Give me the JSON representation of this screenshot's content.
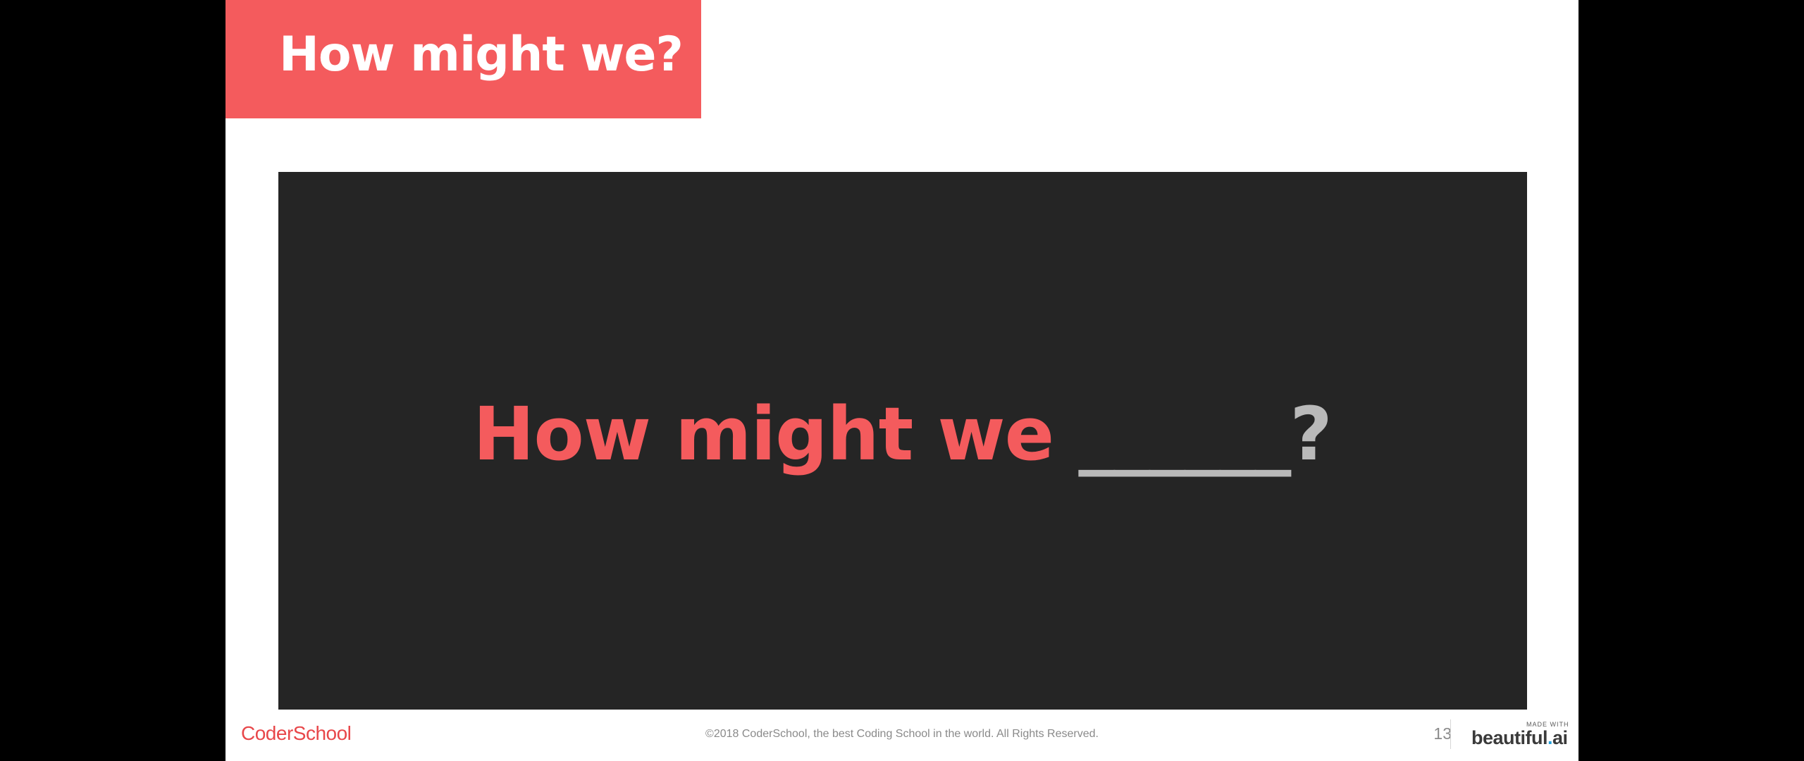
{
  "slide": {
    "title": "How might we?",
    "headline_main": "How might we ",
    "headline_blank": "______",
    "headline_end": "?"
  },
  "footer": {
    "brand": "CoderSchool",
    "copyright": "©2018 CoderSchool, the best Coding School in the world. All Rights Reserved.",
    "page_number": "13",
    "made_with": "MADE WITH",
    "maker_name": "beautiful",
    "maker_dot": ".",
    "maker_suffix": "ai"
  },
  "colors": {
    "accent": "#f45b5d",
    "panel": "#252525",
    "muted_text": "#b9b9b9"
  }
}
